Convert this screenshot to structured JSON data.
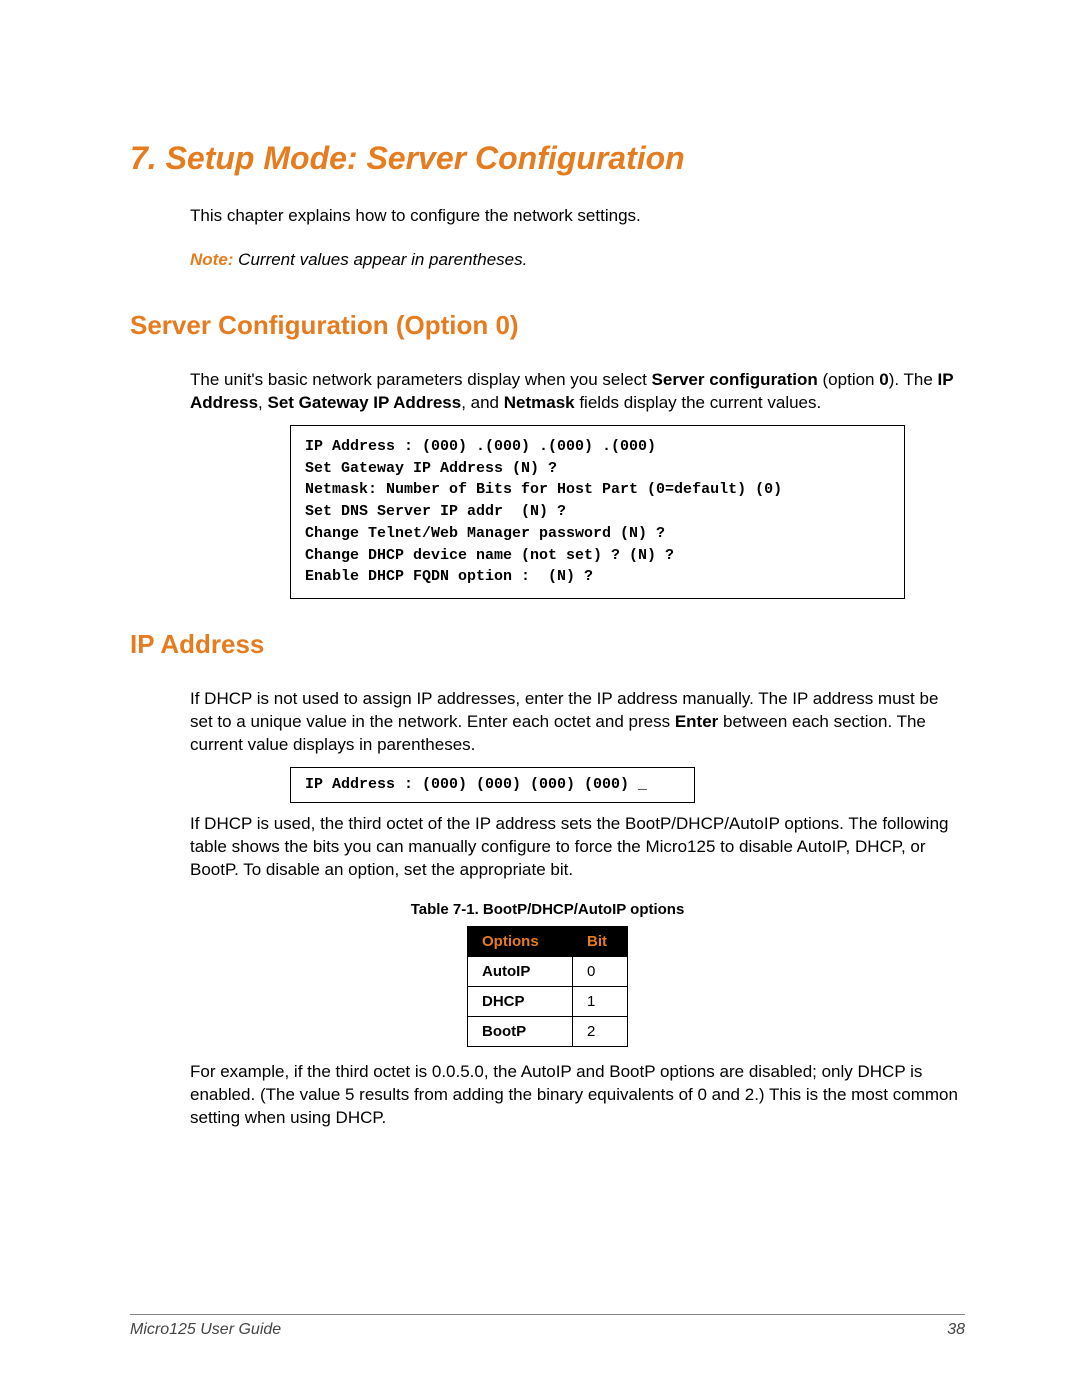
{
  "chapter": {
    "title": "7.  Setup Mode: Server Configuration"
  },
  "intro": "This chapter explains how to configure the network settings.",
  "note": {
    "label": "Note:",
    "text": " Current values appear in parentheses."
  },
  "section_server_config": {
    "heading": "Server Configuration (Option 0)",
    "p1_a": "The unit's basic network parameters display when you select ",
    "p1_b": "Server configuration",
    "p1_c": " (option ",
    "p1_d": "0",
    "p1_e": "). The ",
    "p1_f": "IP Address",
    "p1_g": ", ",
    "p1_h": "Set Gateway IP Address",
    "p1_i": ", and ",
    "p1_j": "Netmask",
    "p1_k": " fields display the current values.",
    "code": "IP Address : (000) .(000) .(000) .(000)\nSet Gateway IP Address (N) ?\nNetmask: Number of Bits for Host Part (0=default) (0)\nSet DNS Server IP addr  (N) ?\nChange Telnet/Web Manager password (N) ?\nChange DHCP device name (not set) ? (N) ?\nEnable DHCP FQDN option :  (N) ?"
  },
  "section_ip": {
    "heading": "IP Address",
    "p1_a": "If DHCP is not used to assign IP addresses, enter the IP address manually. The IP address must be set to a unique value in the network. Enter each octet and press ",
    "p1_b": "Enter",
    "p1_c": " between each section. The current value displays in parentheses.",
    "code": "IP Address : (000) (000) (000) (000) _",
    "p2": "If DHCP is used, the third octet of the IP address sets the BootP/DHCP/AutoIP options. The following table shows the bits you can manually configure to force the Micro125 to disable AutoIP, DHCP, or BootP. To disable an option, set the appropriate bit.",
    "table_caption": "Table 7-1. BootP/DHCP/AutoIP options",
    "table": {
      "headers": [
        "Options",
        "Bit"
      ],
      "rows": [
        {
          "option": "AutoIP",
          "bit": "0"
        },
        {
          "option": "DHCP",
          "bit": "1"
        },
        {
          "option": "BootP",
          "bit": "2"
        }
      ]
    },
    "p3": "For example, if the third octet is 0.0.5.0, the AutoIP and BootP options are disabled; only DHCP is enabled. (The value 5 results from adding the binary equivalents of 0 and 2.) This is the most common setting when using DHCP."
  },
  "footer": {
    "left": "Micro125 User Guide",
    "right": "38"
  }
}
